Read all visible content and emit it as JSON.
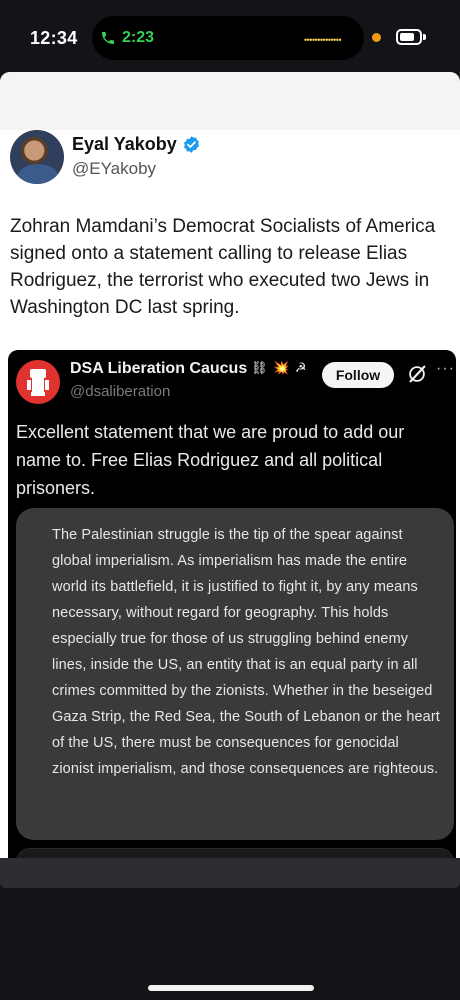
{
  "status_bar": {
    "time": "12:34",
    "call_time": "2:23",
    "call_color": "#34d058",
    "indicator_dots": "••••••••••••••"
  },
  "tweet": {
    "author_name": "Eyal Yakoby",
    "author_handle": "@EYakoby",
    "verified_icon": "verified-badge-icon",
    "text": "Zohran Mamdani’s Democrat Socialists of America signed onto a statement calling to release Elias Rodriguez, the terrorist who executed two Jews in Washington DC last spring."
  },
  "quoted_post": {
    "author_name": "DSA Liberation Caucus",
    "author_emoji": "⛓ 💥 ☭",
    "author_handle": "@dsaliberation",
    "follow_label": "Follow",
    "more_label": "···",
    "text": "Excellent statement that we are proud to add our name to. Free Elias Rodriguez and all political prisoners.",
    "statement_image_text": "The Palestinian struggle is the tip of the spear against global imperialism. As imperialism has made the entire world its battlefield, it is justified to fight it, by any means necessary, without regard for geography. This holds especially true for those of us struggling behind enemy lines, inside the US, an entity that is an equal party in all crimes committed by the zionists. Whether in the beseiged Gaza Strip, the Red Sea, the South of Lebanon or the heart of the US, there must be consequences for genocidal zionist imperialism, and those consequences are righteous."
  },
  "colors": {
    "background": "#121418",
    "quote_background": "#000000",
    "statement_background": "#3a3a3b",
    "verified_blue": "#1d9bf0",
    "dsa_red": "#e0322f"
  }
}
